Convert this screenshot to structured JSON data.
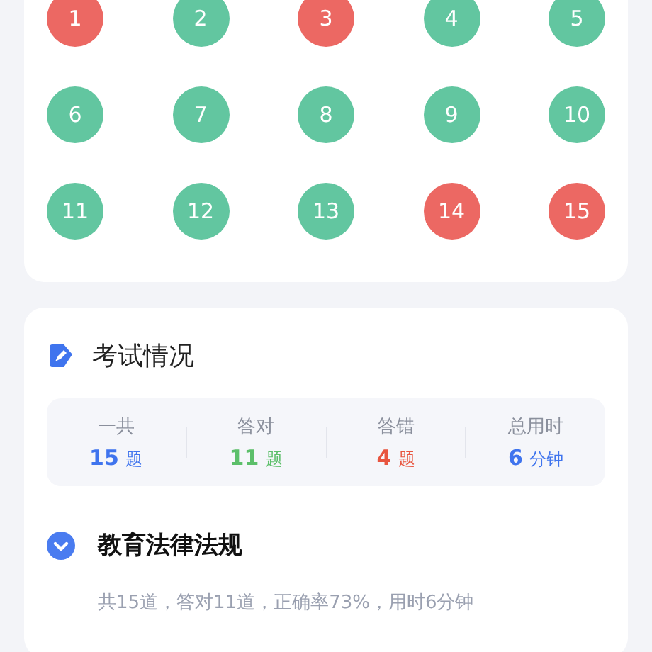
{
  "answer_sheet": [
    {
      "number": "1",
      "correct": false
    },
    {
      "number": "2",
      "correct": true
    },
    {
      "number": "3",
      "correct": false
    },
    {
      "number": "4",
      "correct": true
    },
    {
      "number": "5",
      "correct": true
    },
    {
      "number": "6",
      "correct": true
    },
    {
      "number": "7",
      "correct": true
    },
    {
      "number": "8",
      "correct": true
    },
    {
      "number": "9",
      "correct": true
    },
    {
      "number": "10",
      "correct": true
    },
    {
      "number": "11",
      "correct": true
    },
    {
      "number": "12",
      "correct": true
    },
    {
      "number": "13",
      "correct": true
    },
    {
      "number": "14",
      "correct": false
    },
    {
      "number": "15",
      "correct": false
    }
  ],
  "exam_summary": {
    "title": "考试情况",
    "stats": [
      {
        "label": "一共",
        "value": "15",
        "unit": "题",
        "color": "#3f74ee"
      },
      {
        "label": "答对",
        "value": "11",
        "unit": "题",
        "color": "#5cbf6a"
      },
      {
        "label": "答错",
        "value": "4",
        "unit": "题",
        "color": "#e8553f"
      },
      {
        "label": "总用时",
        "value": "6",
        "unit": "分钟",
        "color": "#3f74ee"
      }
    ],
    "category": {
      "title": "教育法律法规",
      "detail": "共15道，答对11道，正确率73%，用时6分钟"
    }
  }
}
